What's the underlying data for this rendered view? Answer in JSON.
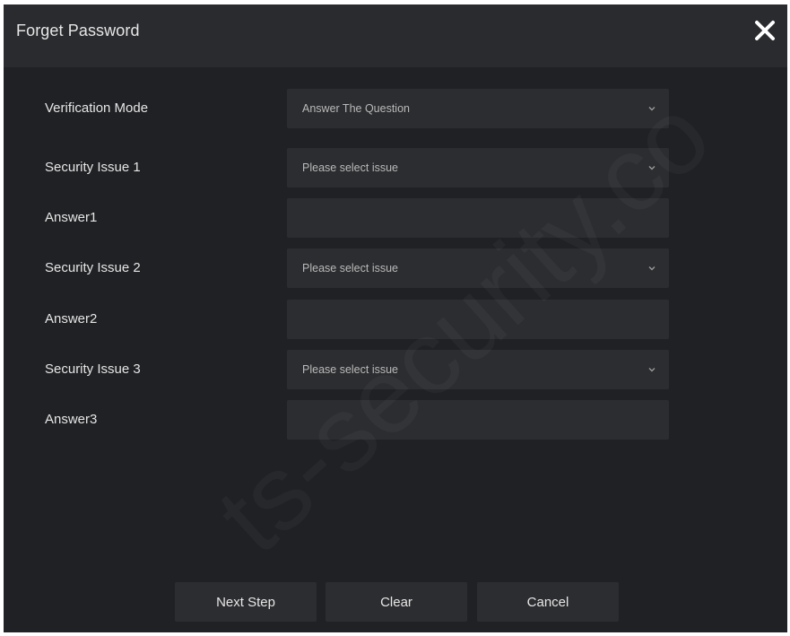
{
  "dialog": {
    "title": "Forget Password",
    "close_icon": "close-icon"
  },
  "form": {
    "rows": [
      {
        "label": "Verification Mode",
        "type": "select",
        "value": "Answer The Question"
      },
      {
        "label": "Security Issue 1",
        "type": "select",
        "value": "Please select issue"
      },
      {
        "label": "Answer1",
        "type": "input",
        "value": ""
      },
      {
        "label": "Security Issue 2",
        "type": "select",
        "value": "Please select issue"
      },
      {
        "label": "Answer2",
        "type": "input",
        "value": ""
      },
      {
        "label": "Security Issue 3",
        "type": "select",
        "value": "Please select issue"
      },
      {
        "label": "Answer3",
        "type": "input",
        "value": ""
      }
    ]
  },
  "buttons": {
    "next_step": "Next Step",
    "clear": "Clear",
    "cancel": "Cancel"
  },
  "watermark": "ts-security.co",
  "colors": {
    "background": "#202124",
    "titlebar": "#2a2b2e",
    "field": "#2c2d30",
    "text": "#e6e6e6"
  }
}
